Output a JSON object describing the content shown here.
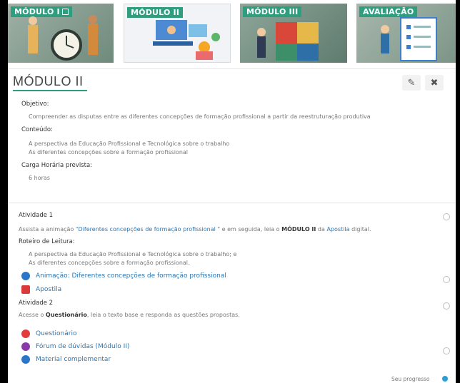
{
  "banner": {
    "modules": [
      {
        "label": "MÓDULO I",
        "active": false
      },
      {
        "label": "MÓDULO II",
        "active": true
      },
      {
        "label": "MÓDULO III",
        "active": false
      },
      {
        "label": "AVALIAÇÃO",
        "active": false
      }
    ]
  },
  "header": {
    "title": "MÓDULO II",
    "edit_icon": "pencil-icon",
    "close_icon": "close-icon"
  },
  "info": {
    "objetivo_label": "Objetivo:",
    "objetivo_text": "Compreender as disputas entre as diferentes concepções de formação profissional a partir da reestruturação produtiva",
    "conteudo_label": "Conteúdo:",
    "conteudo_items": [
      "A perspectiva da Educação Profissional e Tecnológica sobre o trabalho",
      "As diferentes concepções sobre a formação profissional"
    ],
    "carga_label": "Carga Horária prevista:",
    "carga_value": "6 horas"
  },
  "atividade1": {
    "title": "Atividade 1",
    "text_1": "Assista a animação \"",
    "link_1": "Diferentes concepções de formação profissional",
    "text_2": " \" e em seguida, leia o ",
    "bold_1": "MÓDULO II",
    "text_3": " da ",
    "link_2": "Apostila",
    "text_4": " digital.",
    "roteiro_label": "Roteiro de Leitura:",
    "roteiro_items": [
      "A perspectiva da Educação Profissional e Tecnológica sobre o trabalho; e",
      "As diferentes concepções sobre a formação profissional."
    ],
    "resources": [
      {
        "label": "Animação: Diferentes concepções de formação profissional",
        "icon": "animation-icon",
        "color": "#2a76c8"
      },
      {
        "label": "Apostila",
        "icon": "pdf-icon",
        "color": "#d93a3a"
      }
    ]
  },
  "atividade2": {
    "title": "Atividade 2",
    "text_1": "Acesse o ",
    "bold_1": "Questionário",
    "text_2": ", leia o texto base e responda as questões propostas.",
    "resources": [
      {
        "label": "Questionário",
        "icon": "quiz-icon",
        "color": "#e23c3c"
      },
      {
        "label": "Fórum de dúvidas (Módulo II)",
        "icon": "forum-icon",
        "color": "#8a3aa8"
      },
      {
        "label": "Material complementar",
        "icon": "folder-icon",
        "color": "#2a76c8"
      }
    ]
  },
  "footer": {
    "progress_label": "Seu progresso",
    "help_icon": "help-icon"
  }
}
